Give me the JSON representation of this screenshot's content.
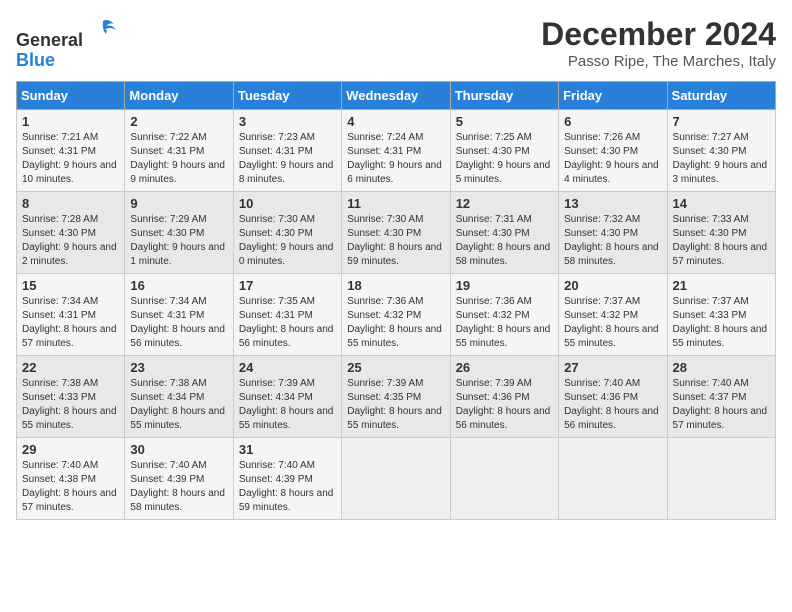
{
  "logo": {
    "general": "General",
    "blue": "Blue"
  },
  "header": {
    "title": "December 2024",
    "subtitle": "Passo Ripe, The Marches, Italy"
  },
  "weekdays": [
    "Sunday",
    "Monday",
    "Tuesday",
    "Wednesday",
    "Thursday",
    "Friday",
    "Saturday"
  ],
  "weeks": [
    [
      {
        "day": "1",
        "sunrise": "7:21 AM",
        "sunset": "4:31 PM",
        "daylight": "9 hours and 10 minutes."
      },
      {
        "day": "2",
        "sunrise": "7:22 AM",
        "sunset": "4:31 PM",
        "daylight": "9 hours and 9 minutes."
      },
      {
        "day": "3",
        "sunrise": "7:23 AM",
        "sunset": "4:31 PM",
        "daylight": "9 hours and 8 minutes."
      },
      {
        "day": "4",
        "sunrise": "7:24 AM",
        "sunset": "4:31 PM",
        "daylight": "9 hours and 6 minutes."
      },
      {
        "day": "5",
        "sunrise": "7:25 AM",
        "sunset": "4:30 PM",
        "daylight": "9 hours and 5 minutes."
      },
      {
        "day": "6",
        "sunrise": "7:26 AM",
        "sunset": "4:30 PM",
        "daylight": "9 hours and 4 minutes."
      },
      {
        "day": "7",
        "sunrise": "7:27 AM",
        "sunset": "4:30 PM",
        "daylight": "9 hours and 3 minutes."
      }
    ],
    [
      {
        "day": "8",
        "sunrise": "7:28 AM",
        "sunset": "4:30 PM",
        "daylight": "9 hours and 2 minutes."
      },
      {
        "day": "9",
        "sunrise": "7:29 AM",
        "sunset": "4:30 PM",
        "daylight": "9 hours and 1 minute."
      },
      {
        "day": "10",
        "sunrise": "7:30 AM",
        "sunset": "4:30 PM",
        "daylight": "9 hours and 0 minutes."
      },
      {
        "day": "11",
        "sunrise": "7:30 AM",
        "sunset": "4:30 PM",
        "daylight": "8 hours and 59 minutes."
      },
      {
        "day": "12",
        "sunrise": "7:31 AM",
        "sunset": "4:30 PM",
        "daylight": "8 hours and 58 minutes."
      },
      {
        "day": "13",
        "sunrise": "7:32 AM",
        "sunset": "4:30 PM",
        "daylight": "8 hours and 58 minutes."
      },
      {
        "day": "14",
        "sunrise": "7:33 AM",
        "sunset": "4:30 PM",
        "daylight": "8 hours and 57 minutes."
      }
    ],
    [
      {
        "day": "15",
        "sunrise": "7:34 AM",
        "sunset": "4:31 PM",
        "daylight": "8 hours and 57 minutes."
      },
      {
        "day": "16",
        "sunrise": "7:34 AM",
        "sunset": "4:31 PM",
        "daylight": "8 hours and 56 minutes."
      },
      {
        "day": "17",
        "sunrise": "7:35 AM",
        "sunset": "4:31 PM",
        "daylight": "8 hours and 56 minutes."
      },
      {
        "day": "18",
        "sunrise": "7:36 AM",
        "sunset": "4:32 PM",
        "daylight": "8 hours and 55 minutes."
      },
      {
        "day": "19",
        "sunrise": "7:36 AM",
        "sunset": "4:32 PM",
        "daylight": "8 hours and 55 minutes."
      },
      {
        "day": "20",
        "sunrise": "7:37 AM",
        "sunset": "4:32 PM",
        "daylight": "8 hours and 55 minutes."
      },
      {
        "day": "21",
        "sunrise": "7:37 AM",
        "sunset": "4:33 PM",
        "daylight": "8 hours and 55 minutes."
      }
    ],
    [
      {
        "day": "22",
        "sunrise": "7:38 AM",
        "sunset": "4:33 PM",
        "daylight": "8 hours and 55 minutes."
      },
      {
        "day": "23",
        "sunrise": "7:38 AM",
        "sunset": "4:34 PM",
        "daylight": "8 hours and 55 minutes."
      },
      {
        "day": "24",
        "sunrise": "7:39 AM",
        "sunset": "4:34 PM",
        "daylight": "8 hours and 55 minutes."
      },
      {
        "day": "25",
        "sunrise": "7:39 AM",
        "sunset": "4:35 PM",
        "daylight": "8 hours and 55 minutes."
      },
      {
        "day": "26",
        "sunrise": "7:39 AM",
        "sunset": "4:36 PM",
        "daylight": "8 hours and 56 minutes."
      },
      {
        "day": "27",
        "sunrise": "7:40 AM",
        "sunset": "4:36 PM",
        "daylight": "8 hours and 56 minutes."
      },
      {
        "day": "28",
        "sunrise": "7:40 AM",
        "sunset": "4:37 PM",
        "daylight": "8 hours and 57 minutes."
      }
    ],
    [
      {
        "day": "29",
        "sunrise": "7:40 AM",
        "sunset": "4:38 PM",
        "daylight": "8 hours and 57 minutes."
      },
      {
        "day": "30",
        "sunrise": "7:40 AM",
        "sunset": "4:39 PM",
        "daylight": "8 hours and 58 minutes."
      },
      {
        "day": "31",
        "sunrise": "7:40 AM",
        "sunset": "4:39 PM",
        "daylight": "8 hours and 59 minutes."
      },
      null,
      null,
      null,
      null
    ]
  ]
}
